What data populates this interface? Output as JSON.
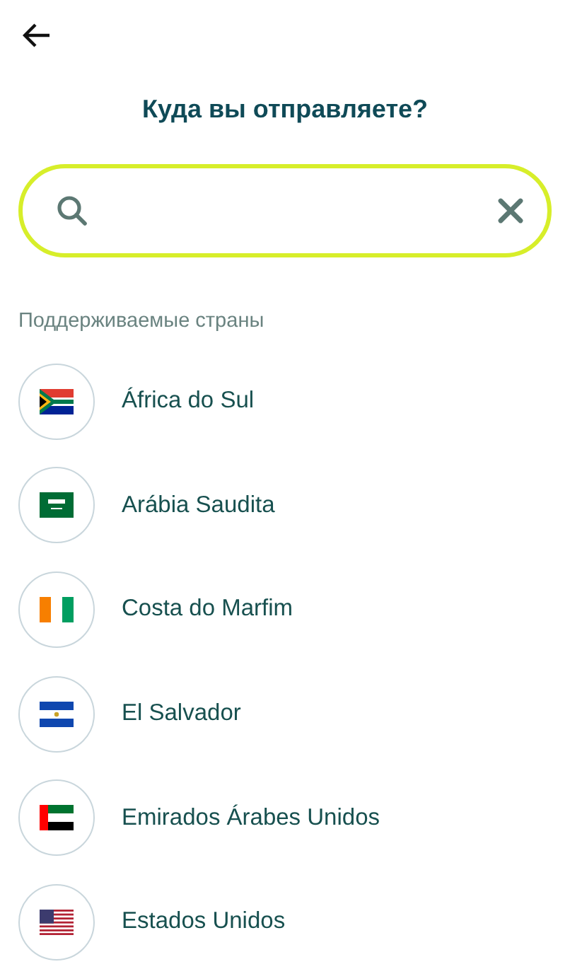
{
  "title": "Куда вы отправляете?",
  "section_label": "Поддерживаемые страны",
  "countries": [
    {
      "name": "África do Sul",
      "kind": "za"
    },
    {
      "name": "Arábia Saudita",
      "kind": "sa"
    },
    {
      "name": "Costa do Marfim",
      "kind": "ci"
    },
    {
      "name": "El Salvador",
      "kind": "sv"
    },
    {
      "name": "Emirados Árabes Unidos",
      "kind": "ae"
    },
    {
      "name": "Estados Unidos",
      "kind": "us"
    }
  ]
}
